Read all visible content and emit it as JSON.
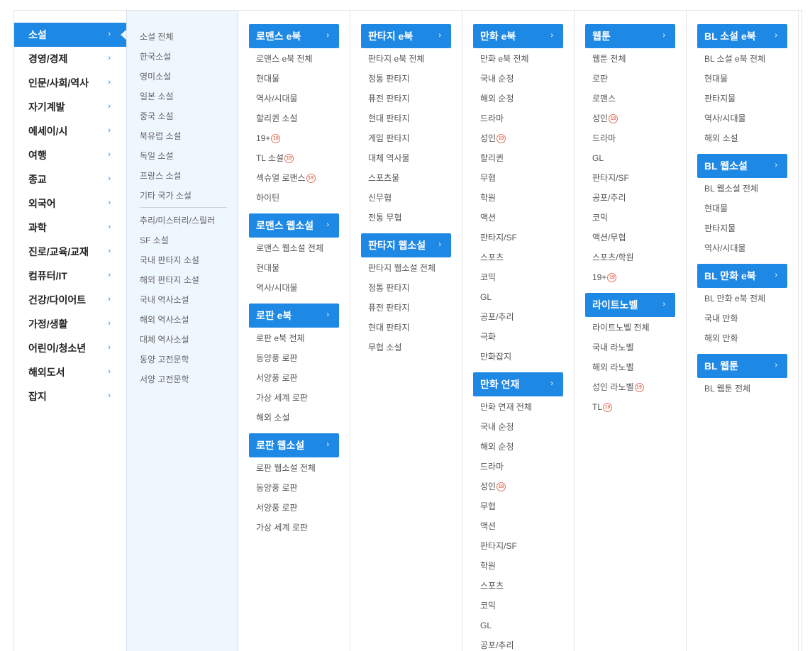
{
  "main_categories": [
    "소설",
    "경영/경제",
    "인문/사회/역사",
    "자기계발",
    "에세이/시",
    "여행",
    "종교",
    "외국어",
    "과학",
    "진로/교육/교재",
    "컴퓨터/IT",
    "건강/다이어트",
    "가정/생활",
    "어린이/청소년",
    "해외도서",
    "잡지"
  ],
  "active_main": "소설",
  "sub_categories": {
    "group1": [
      "소설 전체",
      "한국소설",
      "영미소설",
      "일본 소설",
      "중국 소설",
      "북유럽 소설",
      "독일 소설",
      "프랑스 소설",
      "기타 국가 소설"
    ],
    "group2": [
      "추리/미스터리/스릴러",
      "SF 소설",
      "국내 판타지 소설",
      "해외 판타지 소설",
      "국내 역사소설",
      "해외 역사소설",
      "대체 역사소설",
      "동양 고전문학",
      "서양 고전문학"
    ]
  },
  "badge_text": "19",
  "accent_color": "#1e88e5",
  "badge_color": "#e6735c",
  "columns": [
    [
      {
        "title": "로맨스 e북",
        "items": [
          {
            "label": "로맨스 e북 전체"
          },
          {
            "label": "현대물"
          },
          {
            "label": "역사/시대물"
          },
          {
            "label": "할리퀸 소설"
          },
          {
            "label": "19+",
            "badge": true
          },
          {
            "label": "TL 소설",
            "badge": true
          },
          {
            "label": "섹슈얼 로맨스",
            "badge": true
          },
          {
            "label": "하이틴"
          }
        ]
      },
      {
        "title": "로맨스 웹소설",
        "items": [
          {
            "label": "로맨스 웹소설 전체"
          },
          {
            "label": "현대물"
          },
          {
            "label": "역사/시대물"
          }
        ]
      },
      {
        "title": "로판 e북",
        "items": [
          {
            "label": "로판 e북 전체"
          },
          {
            "label": "동양풍 로판"
          },
          {
            "label": "서양풍 로판"
          },
          {
            "label": "가상 세계 로판"
          },
          {
            "label": "해외 소설"
          }
        ]
      },
      {
        "title": "로판 웹소설",
        "items": [
          {
            "label": "로판 웹소설 전체"
          },
          {
            "label": "동양풍 로판"
          },
          {
            "label": "서양풍 로판"
          },
          {
            "label": "가상 세계 로판"
          }
        ]
      }
    ],
    [
      {
        "title": "판타지 e북",
        "items": [
          {
            "label": "판타지 e북 전체"
          },
          {
            "label": "정통 판타지"
          },
          {
            "label": "퓨전 판타지"
          },
          {
            "label": "현대 판타지"
          },
          {
            "label": "게임 판타지"
          },
          {
            "label": "대체 역사물"
          },
          {
            "label": "스포츠물"
          },
          {
            "label": "신무협"
          },
          {
            "label": "전통 무협"
          }
        ]
      },
      {
        "title": "판타지 웹소설",
        "items": [
          {
            "label": "판타지 웹소설 전체"
          },
          {
            "label": "정통 판타지"
          },
          {
            "label": "퓨전 판타지"
          },
          {
            "label": "현대 판타지"
          },
          {
            "label": "무협 소설"
          }
        ]
      }
    ],
    [
      {
        "title": "만화 e북",
        "items": [
          {
            "label": "만화 e북 전체"
          },
          {
            "label": "국내 순정"
          },
          {
            "label": "해외 순정"
          },
          {
            "label": "드라마"
          },
          {
            "label": "성인",
            "badge": true
          },
          {
            "label": "할리퀸"
          },
          {
            "label": "무협"
          },
          {
            "label": "학원"
          },
          {
            "label": "액션"
          },
          {
            "label": "판타지/SF"
          },
          {
            "label": "스포츠"
          },
          {
            "label": "코믹"
          },
          {
            "label": "GL"
          },
          {
            "label": "공포/추리"
          },
          {
            "label": "극화"
          },
          {
            "label": "만화잡지"
          }
        ]
      },
      {
        "title": "만화 연재",
        "items": [
          {
            "label": "만화 연재 전체"
          },
          {
            "label": "국내 순정"
          },
          {
            "label": "해외 순정"
          },
          {
            "label": "드라마"
          },
          {
            "label": "성인",
            "badge": true
          },
          {
            "label": "무협"
          },
          {
            "label": "액션"
          },
          {
            "label": "판타지/SF"
          },
          {
            "label": "학원"
          },
          {
            "label": "스포츠"
          },
          {
            "label": "코믹"
          },
          {
            "label": "GL"
          },
          {
            "label": "공포/추리"
          }
        ]
      }
    ],
    [
      {
        "title": "웹툰",
        "items": [
          {
            "label": "웹툰 전체"
          },
          {
            "label": "로판"
          },
          {
            "label": "로맨스"
          },
          {
            "label": "성인",
            "badge": true
          },
          {
            "label": "드라마"
          },
          {
            "label": "GL"
          },
          {
            "label": "판타지/SF"
          },
          {
            "label": "공포/추리"
          },
          {
            "label": "코믹"
          },
          {
            "label": "액션/무협"
          },
          {
            "label": "스포츠/학원"
          },
          {
            "label": "19+",
            "badge": true
          }
        ]
      },
      {
        "title": "라이트노벨",
        "items": [
          {
            "label": "라이트노벨 전체"
          },
          {
            "label": "국내 라노벨"
          },
          {
            "label": "해외 라노벨"
          },
          {
            "label": "성인 라노벨",
            "badge": true
          },
          {
            "label": "TL",
            "badge": true
          }
        ]
      }
    ],
    [
      {
        "title": "BL 소설 e북",
        "items": [
          {
            "label": "BL 소설 e북 전체"
          },
          {
            "label": "현대물"
          },
          {
            "label": "판타지물"
          },
          {
            "label": "역사/시대물"
          },
          {
            "label": "해외 소설"
          }
        ]
      },
      {
        "title": "BL 웹소설",
        "items": [
          {
            "label": "BL 웹소설 전체"
          },
          {
            "label": "현대물"
          },
          {
            "label": "판타지물"
          },
          {
            "label": "역사/시대물"
          }
        ]
      },
      {
        "title": "BL 만화 e북",
        "items": [
          {
            "label": "BL 만화 e북 전체"
          },
          {
            "label": "국내 만화"
          },
          {
            "label": "해외 만화"
          }
        ]
      },
      {
        "title": "BL 웹툰",
        "items": [
          {
            "label": "BL 웹툰 전체"
          }
        ]
      }
    ]
  ]
}
